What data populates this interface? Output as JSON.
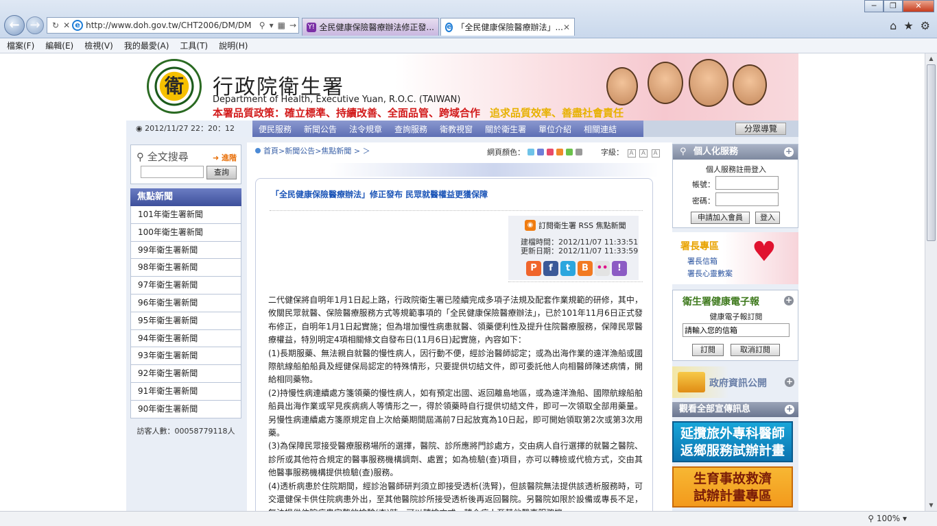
{
  "browser": {
    "url": "http://www.doh.gov.tw/CHT2006/DM/DM",
    "tabs": [
      {
        "label": "全民健康保險醫療辦法修正發..."
      },
      {
        "label": "「全民健康保險醫療辦法」..."
      }
    ],
    "menu": [
      "檔案(F)",
      "編輯(E)",
      "檢視(V)",
      "我的最愛(A)",
      "工具(T)",
      "說明(H)"
    ],
    "zoom": "100%"
  },
  "header": {
    "org_name": "行政院衛生署",
    "org_en": "Department of Health, Executive Yuan, R.O.C. (TAIWAN)",
    "policy": "本署品質政策：確立標準、持續改善、全面品管、跨域合作",
    "policy2": "追求品質效率、善盡社會責任",
    "logo_char": "衛"
  },
  "nav": {
    "datetime": "2012/11/27 22：20：12",
    "items": [
      "便民服務",
      "新聞公告",
      "法令規章",
      "查詢服務",
      "衛教視窗",
      "關於衛生署",
      "單位介紹",
      "相關連結"
    ],
    "sitemap": "分眾導覽"
  },
  "left": {
    "search_title": "全文搜尋",
    "advanced": "進階",
    "search_btn": "查詢",
    "news_header": "焦點新聞",
    "news": [
      "101年衛生署新聞",
      "100年衛生署新聞",
      "99年衛生署新聞",
      "98年衛生署新聞",
      "97年衛生署新聞",
      "96年衛生署新聞",
      "95年衛生署新聞",
      "94年衛生署新聞",
      "93年衛生署新聞",
      "92年衛生署新聞",
      "91年衛生署新聞",
      "90年衛生署新聞"
    ],
    "visitors": "訪客人數：00058779118人"
  },
  "content": {
    "breadcrumb": "首頁>新聞公告>焦點新聞 > ＞",
    "color_label": "網頁顏色：",
    "colors": [
      "#6fc3e8",
      "#6f7fd8",
      "#e84a6a",
      "#f08a2a",
      "#6ac24a",
      "#9a9a9a"
    ],
    "font_label": "字級：",
    "font_sizes": [
      "A",
      "A",
      "A"
    ],
    "title": "「全民健康保險醫療辦法」修正發布 民眾就醫權益更獲保障",
    "rss": "訂閱衛生署 RSS 焦點新聞",
    "created": "建檔時間：2012/11/07 11:33:51",
    "updated": "更新日期：2012/11/07 11:33:59",
    "share": [
      {
        "icon": "plurk-icon",
        "glyph": "P",
        "color": "#f0652c"
      },
      {
        "icon": "facebook-icon",
        "glyph": "f",
        "color": "#3b5998"
      },
      {
        "icon": "twitter-icon",
        "glyph": "t",
        "color": "#2ba6de"
      },
      {
        "icon": "blogger-icon",
        "glyph": "B",
        "color": "#f27a22"
      },
      {
        "icon": "flickr-icon",
        "glyph": "••",
        "color": "#e3e3e3"
      },
      {
        "icon": "yahoo-icon",
        "glyph": "!",
        "color": "#8c5cc4"
      }
    ],
    "paragraphs": [
      "二代健保將自明年1月1日起上路，行政院衛生署已陸續完成多項子法規及配套作業規範的研修，其中，攸關民眾就醫、保險醫療服務方式等規範事項的「全民健康保險醫療辦法」，已於101年11月6日正式發布修正，自明年1月1日起實施；但為增加慢性病患就醫、領藥便利性及提升住院醫療服務，保障民眾醫療權益，特別明定4項相關條文自發布日(11月6日)起實施，內容如下：",
      "(1)長期服藥、無法親自就醫的慢性病人，因行動不便，經診治醫師認定；或為出海作業的遠洋漁船或國際航線船舶船員及經健保局認定的特殊情形，只要提供切結文件，即可委託他人向相醫師陳述病情，開給相同藥物。",
      "(2)持慢性病連續處方箋領藥的慢性病人，如有預定出國、返回離島地區，或為遠洋漁船、國際航線船舶船員出海作業或罕見疾病病人等情形之一，得於領藥時自行提供切結文件，即可一次領取全部用藥量。另慢性病連續處方箋原規定自上次給藥期間屆滿前7日起放寬為10日起，即可開始領取第2次或第3次用藥。",
      "(3)為保障民眾接受醫療服務場所的選擇，醫院、診所應將門診處方，交由病人自行選擇的就醫之醫院、診所或其他符合規定的醫事服務機構調劑、處置；如為檢驗(查)項目，亦可以轉檢或代檢方式，交由其他醫事服務機構提供檢驗(查)服務。",
      "(4)透析病患於住院期間，經診治醫師研判須立即接受透析(洗腎)，但該醫院無法提供該透析服務時，可交還健保卡供住院病患外出，至其他醫院診所接受透析後再返回醫院。另醫院如限於設備或專長不足，無法提供住院病患完整的檢驗(查)時，可以轉檢方式，轉介病人至其他醫事服務機"
    ]
  },
  "right": {
    "member_title": "個人化服務",
    "member_sub": "個人服務註冊登入",
    "account_label": "帳號：",
    "password_label": "密碼：",
    "join_btn": "申請加入會員",
    "login_btn": "登入",
    "director_title": "署長專區",
    "director_links": [
      "署長信箱",
      "署長心靈數案"
    ],
    "enews_title": "衛生署健康電子報",
    "enews_sub": "健康電子報訂閱",
    "enews_placeholder": "請輸入您的信箱",
    "subscribe_btn": "訂閱",
    "unsubscribe_btn": "取消訂閱",
    "govinfo": "政府資訊公開",
    "all_promo": "觀看全部宣傳訊息",
    "promo1": [
      "延攬旅外專科醫師",
      "返鄉服務試辦計畫"
    ],
    "promo2": [
      "生育事故救濟",
      "試辦計畫專區"
    ]
  }
}
